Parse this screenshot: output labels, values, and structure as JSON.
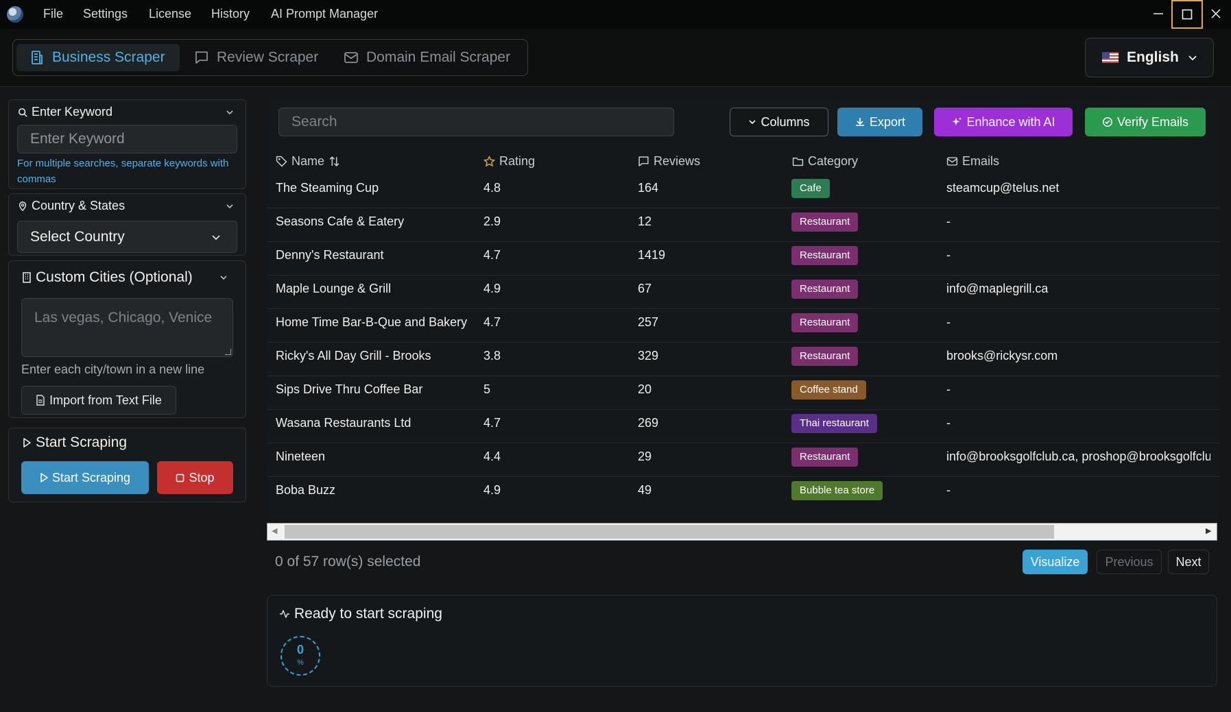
{
  "menu": {
    "items": [
      "File",
      "Settings",
      "License",
      "History",
      "AI Prompt Manager"
    ]
  },
  "tabs": [
    {
      "label": "Business Scraper",
      "icon": "building-icon",
      "active": true
    },
    {
      "label": "Review Scraper",
      "icon": "chat-icon",
      "active": false
    },
    {
      "label": "Domain Email Scraper",
      "icon": "mail-icon",
      "active": false
    }
  ],
  "language": {
    "label": "English",
    "flag": "us-flag-icon"
  },
  "sidebar": {
    "keyword": {
      "title": "Enter Keyword",
      "placeholder": "Enter Keyword",
      "hint": "For multiple searches, separate keywords with commas"
    },
    "country": {
      "title": "Country & States",
      "select_label": "Select Country"
    },
    "cities": {
      "title": "Custom Cities (Optional)",
      "placeholder": "Las vegas, Chicago, Venice",
      "hint": "Enter each city/town in a new line",
      "import_label": "Import from Text File"
    },
    "scraping": {
      "title": "Start Scraping",
      "start_label": "Start Scraping",
      "stop_label": "Stop"
    }
  },
  "toolbar": {
    "search_placeholder": "Search",
    "columns_label": "Columns",
    "export_label": "Export",
    "enhance_label": "Enhance with AI",
    "verify_label": "Verify Emails"
  },
  "table": {
    "headers": {
      "name": "Name",
      "rating": "Rating",
      "reviews": "Reviews",
      "category": "Category",
      "emails": "Emails"
    },
    "rows": [
      {
        "name": "The Steaming Cup",
        "rating": "4.8",
        "reviews": "164",
        "category": "Cafe",
        "color": "#2e7d52",
        "email": "steamcup@telus.net"
      },
      {
        "name": "Seasons Cafe & Eatery",
        "rating": "2.9",
        "reviews": "12",
        "category": "Restaurant",
        "color": "#7b2f6e",
        "email": "-"
      },
      {
        "name": "Denny's Restaurant",
        "rating": "4.7",
        "reviews": "1419",
        "category": "Restaurant",
        "color": "#7b2f6e",
        "email": "-"
      },
      {
        "name": "Maple Lounge & Grill",
        "rating": "4.9",
        "reviews": "67",
        "category": "Restaurant",
        "color": "#7b2f6e",
        "email": "info@maplegrill.ca"
      },
      {
        "name": "Home Time Bar-B-Que and Bakery",
        "rating": "4.7",
        "reviews": "257",
        "category": "Restaurant",
        "color": "#7b2f6e",
        "email": "-"
      },
      {
        "name": "Ricky's All Day Grill - Brooks",
        "rating": "3.8",
        "reviews": "329",
        "category": "Restaurant",
        "color": "#7b2f6e",
        "email": "brooks@rickysr.com"
      },
      {
        "name": "Sips Drive Thru Coffee Bar",
        "rating": "5",
        "reviews": "20",
        "category": "Coffee stand",
        "color": "#8a5a2b",
        "email": "-"
      },
      {
        "name": "Wasana Restaurants Ltd",
        "rating": "4.7",
        "reviews": "269",
        "category": "Thai restaurant",
        "color": "#5a2f8a",
        "email": "-"
      },
      {
        "name": "Nineteen",
        "rating": "4.4",
        "reviews": "29",
        "category": "Restaurant",
        "color": "#7b2f6e",
        "email": "info@brooksgolfclub.ca, proshop@brooksgolfclub"
      },
      {
        "name": "Boba Buzz",
        "rating": "4.9",
        "reviews": "49",
        "category": "Bubble tea store",
        "color": "#4f7a2e",
        "email": "-"
      }
    ]
  },
  "pager": {
    "selection": "0 of 57 row(s) selected",
    "visualize_label": "Visualize",
    "previous_label": "Previous",
    "next_label": "Next"
  },
  "status": {
    "title": "Ready to start scraping",
    "progress_value": "0",
    "progress_unit": "%"
  }
}
